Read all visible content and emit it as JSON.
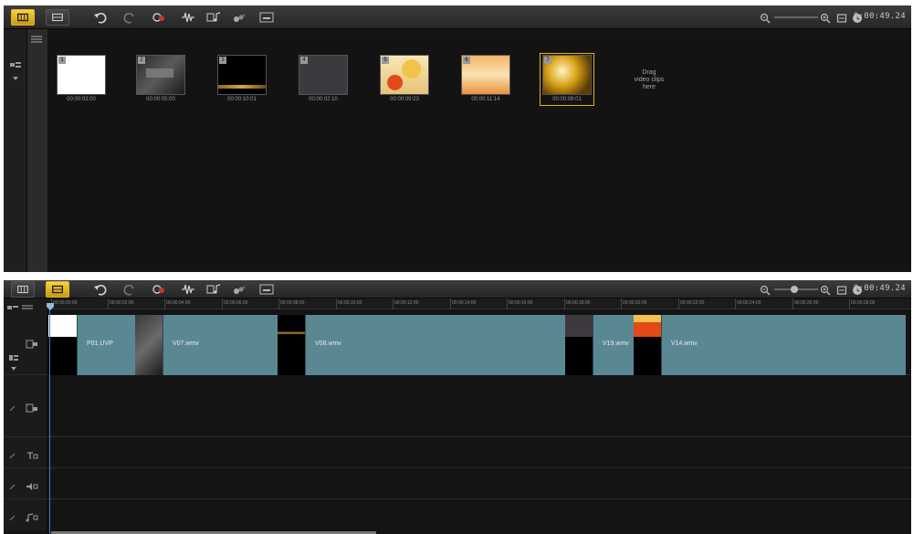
{
  "storyboard": {
    "timecode": "0:00:49.24",
    "clips": [
      {
        "number": "1",
        "duration": "00:00:03:00"
      },
      {
        "number": "2",
        "duration": "00:00:05:00"
      },
      {
        "number": "3",
        "duration": "00:00:10:01"
      },
      {
        "number": "4",
        "duration": "00:00:02:10"
      },
      {
        "number": "5",
        "duration": "00:00:09:23"
      },
      {
        "number": "6",
        "duration": "00:00:11:14"
      },
      {
        "number": "7",
        "duration": "00:00:08:01"
      }
    ],
    "drag_hint": [
      "Drag",
      "video clips",
      "here"
    ]
  },
  "timeline": {
    "timecode": "0:00:49.24",
    "ruler_ticks": [
      "00:00:00:00",
      "00:00:02:00",
      "00:00:04:00",
      "00:00:06:00",
      "00:00:08:00",
      "00:00:10:00",
      "00:00:12:00",
      "00:00:14:00",
      "00:00:16:00",
      "00:00:18:00",
      "00:00:20:00",
      "00:00:22:00",
      "00:00:24:00",
      "00:00:26:00",
      "00:00:28:00"
    ],
    "clip_labels": [
      "P01.UVP",
      "V07.wmv",
      "V08.wmv",
      "V19.wmv",
      "V14.wmv"
    ]
  },
  "colors": {
    "accent": "#e6b21d",
    "clip_fill": "#5a8892",
    "playhead": "#3a7fc0"
  },
  "icons": [
    "storyboard-view-icon",
    "timeline-view-icon",
    "undo-icon",
    "redo-icon",
    "record-capture-icon",
    "sound-mixer-icon",
    "auto-music-icon",
    "motion-tracking-icon",
    "subtitle-icon",
    "zoom-out-icon",
    "zoom-in-icon",
    "fit-to-window-icon",
    "clock-icon"
  ]
}
